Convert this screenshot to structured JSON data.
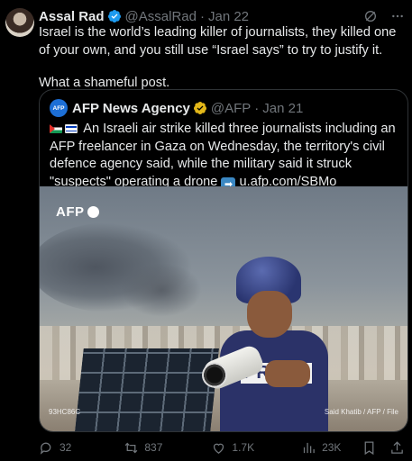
{
  "post": {
    "author_name": "Assal Rad",
    "handle": "@AssalRad",
    "separator": "·",
    "date": "Jan 22",
    "text_line1": "Israel is the world’s leading killer of journalists, they killed one of your own, and you still use “Israel says” to try to justify it.",
    "text_line2": "What a shameful post."
  },
  "quote": {
    "avatar_text": "AFP",
    "author_name": "AFP News Agency",
    "handle": "@AFP",
    "separator": "·",
    "date": "Jan 21",
    "text": "An Israeli air strike killed three journalists including an AFP freelancer in Gaza on Wednesday, the territory's civil defence agency said, while the military said it struck \"suspects\" operating a drone",
    "arrow_emoji": "➡",
    "link": "u.afp.com/SBMo"
  },
  "photo": {
    "logo": "AFP",
    "vest_text": "PRESS",
    "watermark_left": "93HC86C",
    "credit": "Said Khatib / AFP / File"
  },
  "actions": {
    "replies": "32",
    "reposts": "837",
    "likes": "1.7K",
    "views": "23K"
  },
  "colors": {
    "background": "#000000",
    "text": "#e7e9ea",
    "muted": "#71767b",
    "verified": "#1d9bf0",
    "border": "#2f3336"
  }
}
